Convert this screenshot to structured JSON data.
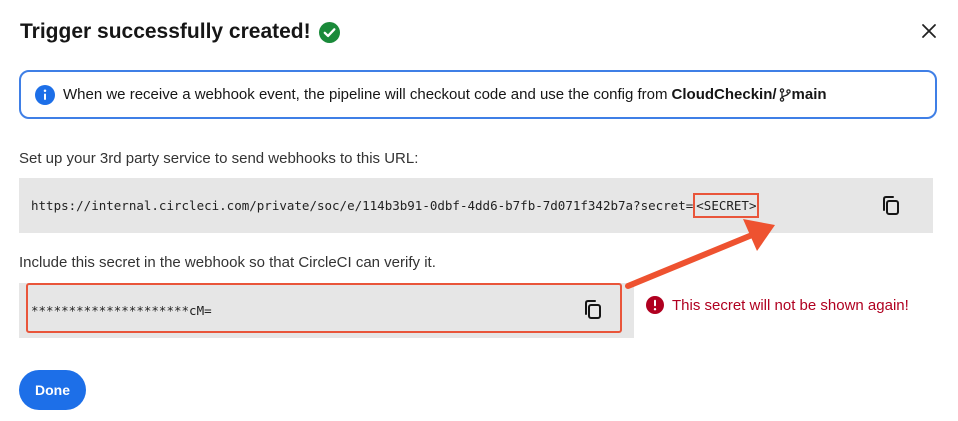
{
  "dialog": {
    "title": "Trigger successfully created!",
    "close_icon": "close-icon",
    "success_icon": "check-circle-icon",
    "accent_color": "#1d6fe8",
    "success_color": "#1a8a3a",
    "error_color": "#b00020",
    "highlight_color": "#e9553a"
  },
  "info": {
    "text": "When we receive a webhook event, the pipeline will checkout code and use the config from",
    "repo": "CloudCheckin/",
    "branch": "main",
    "icon": "info-icon",
    "branch_icon": "git-branch-icon"
  },
  "url_section": {
    "label": "Set up your 3rd party service to send webhooks to this URL:",
    "url": "https://internal.circleci.com/private/soc/e/114b3b91-0dbf-4dd6-b7fb-7d071f342b7a?secret=",
    "secret_placeholder": "<SECRET>",
    "copy_icon": "copy-icon"
  },
  "secret_section": {
    "label": "Include this secret in the webhook so that CircleCI can verify it.",
    "value": "*********************cM=",
    "copy_icon": "copy-icon",
    "warning": "This secret will not be shown again!",
    "warning_icon": "alert-circle-icon"
  },
  "footer": {
    "done_label": "Done"
  }
}
